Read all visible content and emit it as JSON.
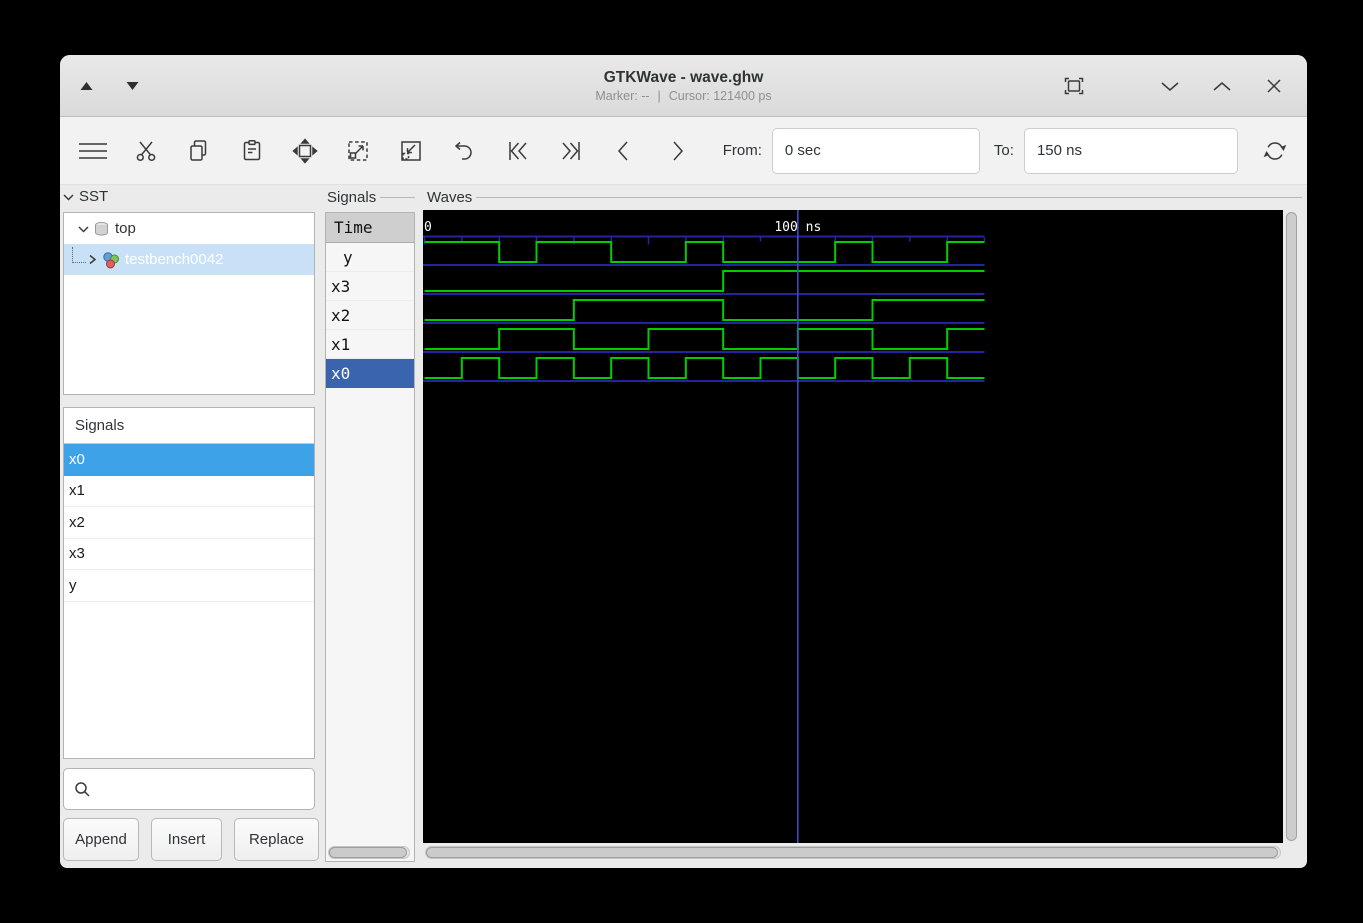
{
  "window": {
    "title": "GTKWave - wave.ghw",
    "status": {
      "marker": "Marker: --",
      "separator": "|",
      "cursor": "Cursor: 121400 ps"
    },
    "controls_left": [
      "triangle-up",
      "triangle-down"
    ],
    "controls_right": [
      "fullscreen",
      "chevron-down",
      "chevron-up",
      "close"
    ]
  },
  "toolbar": {
    "icons": [
      "menu",
      "cut",
      "copy",
      "paste",
      "zoom-fit",
      "zoom-out",
      "zoom-in",
      "undo",
      "go-first",
      "go-last",
      "go-previous",
      "go-next",
      "reload"
    ],
    "from_label": "From:",
    "from_value": "0 sec",
    "to_label": "To:",
    "to_value": "150 ns"
  },
  "sst": {
    "header": "SST",
    "tree": [
      {
        "label": "top"
      },
      {
        "label": "testbench0042"
      }
    ],
    "selected_tree_item": "testbench0042",
    "signals_header": "Signals",
    "signals": [
      "x0",
      "x1",
      "x2",
      "x3",
      "y"
    ],
    "selected_signal": "x0",
    "search_value": "",
    "buttons": [
      "Append",
      "Insert",
      "Replace"
    ]
  },
  "signal_pane": {
    "frame_label": "Signals",
    "time_header": "Time",
    "rows": [
      "y",
      "x3",
      "x2",
      "x1",
      "x0"
    ],
    "selected_row": "x0"
  },
  "waves": {
    "frame_label": "Waves"
  },
  "colors": {
    "list_selection": "#3da2e8",
    "name_selection": "#3a64ad",
    "tree_selection": "#c8e1f7"
  },
  "chart_data": {
    "type": "digital-waveform",
    "time_unit": "ns",
    "t_start": 0,
    "t_end": 150,
    "minor_tick_ns": 10,
    "major_tick_ns": 20,
    "tick_labels": [
      {
        "t": 0,
        "label": "0"
      },
      {
        "t": 100,
        "label": "100 ns"
      }
    ],
    "cursor_ns": 100,
    "signals": [
      {
        "name": "y",
        "initial": 1,
        "transitions": [
          20,
          30,
          50,
          70,
          80,
          110,
          120,
          140
        ]
      },
      {
        "name": "x3",
        "initial": 0,
        "transitions": [
          80
        ]
      },
      {
        "name": "x2",
        "initial": 0,
        "transitions": [
          40,
          80,
          120
        ]
      },
      {
        "name": "x1",
        "initial": 0,
        "transitions": [
          20,
          40,
          60,
          80,
          100,
          120,
          140
        ]
      },
      {
        "name": "x0",
        "initial": 0,
        "transitions": [
          10,
          20,
          30,
          40,
          50,
          60,
          70,
          80,
          90,
          100,
          110,
          120,
          130,
          140
        ]
      }
    ],
    "colors": {
      "background": "#000000",
      "trace": "#00cc00",
      "grid": "#2424a0",
      "cursor": "#4a4ace",
      "text": "#ffffff"
    }
  }
}
